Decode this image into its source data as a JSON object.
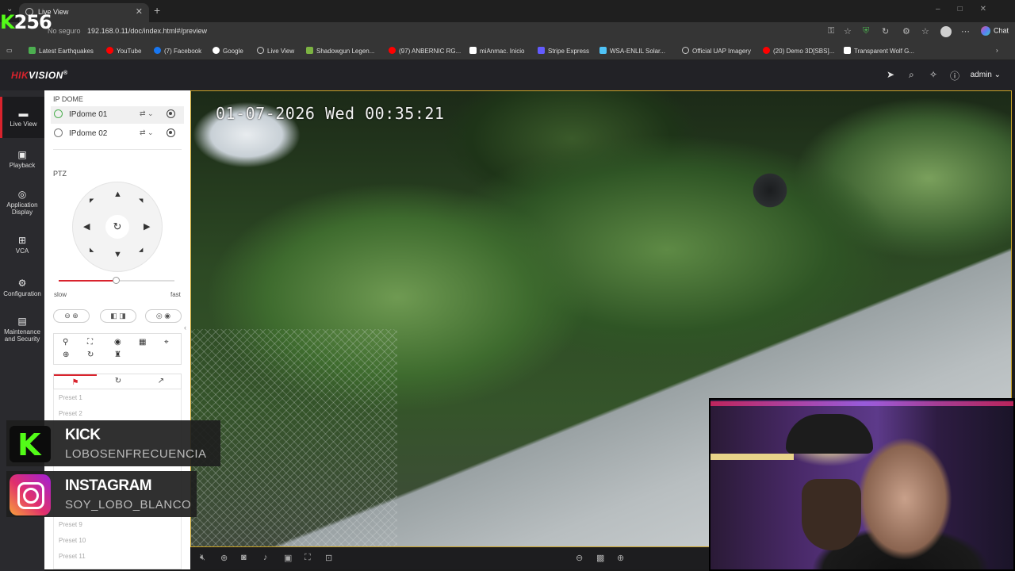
{
  "browser": {
    "tab_title": "Live View",
    "url_security": "No seguro",
    "url": "192.168.0.11/doc/index.html#/preview",
    "chat_label": "Chat",
    "bookmarks": [
      {
        "label": "Latest Earthquakes",
        "color": "#4caf50"
      },
      {
        "label": "YouTube",
        "color": "#ff0000"
      },
      {
        "label": "(7) Facebook",
        "color": "#1877f2"
      },
      {
        "label": "Google",
        "color": "#ffffff"
      },
      {
        "label": "Live View",
        "color": "#cccccc"
      },
      {
        "label": "Shadowgun Legen...",
        "color": "#7cb342"
      },
      {
        "label": "(97) ANBERNIC RG...",
        "color": "#ff0000"
      },
      {
        "label": "miAnmac. Inicio",
        "color": "#ffffff"
      },
      {
        "label": "Stripe Express",
        "color": "#635bff"
      },
      {
        "label": "WSA-ENLIL Solar...",
        "color": "#4fc3f7"
      },
      {
        "label": "Official UAP Imagery",
        "color": "#cccccc"
      },
      {
        "label": "(20) Demo 3D[SBS]...",
        "color": "#ff0000"
      },
      {
        "label": "Transparent Wolf G...",
        "color": "#ffffff"
      }
    ]
  },
  "header": {
    "logo_brand": "HIK",
    "logo_rest": "VISION",
    "logo_mark": "®",
    "user": "admin"
  },
  "nav": [
    {
      "label": "Live View",
      "icon": "monitor-icon",
      "active": true
    },
    {
      "label": "Playback",
      "icon": "playback-icon",
      "active": false
    },
    {
      "label": "Application Display",
      "icon": "app-icon",
      "active": false
    },
    {
      "label": "VCA",
      "icon": "vca-icon",
      "active": false
    },
    {
      "label": "Configuration",
      "icon": "gear-icon",
      "active": false
    },
    {
      "label": "Maintenance and Security",
      "icon": "shield-icon",
      "active": false
    }
  ],
  "panel": {
    "group_title": "IP DOME",
    "cameras": [
      {
        "label": "IPdome 01",
        "selected": true
      },
      {
        "label": "IPdome 02",
        "selected": false
      }
    ],
    "ptz_title": "PTZ",
    "speed_slow": "slow",
    "speed_fast": "fast",
    "speed_value": 0.5,
    "presets": [
      "Preset 1",
      "Preset 2",
      "Preset 9",
      "Preset 10",
      "Preset 11"
    ]
  },
  "video": {
    "osd_timestamp": "01-07-2026 Wed 00:35:21"
  },
  "overlay": {
    "brand_k": "K",
    "brand_num": "256",
    "kick_name": "KICK",
    "kick_handle": "LOBOSENFRECUENCIA",
    "ig_name": "INSTAGRAM",
    "ig_handle": "SOY_LOBO_BLANCO"
  },
  "colors": {
    "accent": "#d9232d",
    "kick_green": "#53fc18",
    "video_border": "#c9a227"
  }
}
